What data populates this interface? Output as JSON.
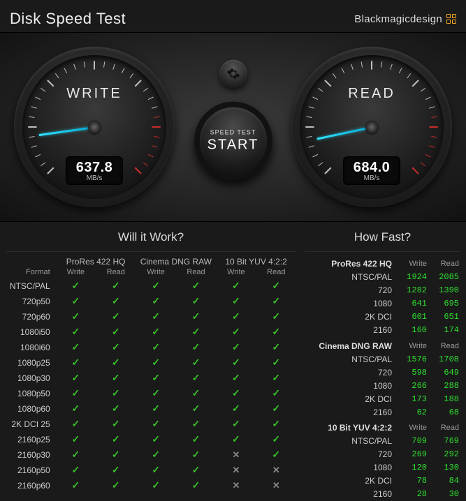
{
  "app": {
    "title": "Disk Speed Test",
    "brand": "Blackmagicdesign"
  },
  "controls": {
    "speed_test_small": "SPEED TEST",
    "start_label": "START"
  },
  "units": "MB/s",
  "gauges": {
    "write": {
      "label": "WRITE",
      "value": "637.8",
      "needle_deg": 172
    },
    "read": {
      "label": "READ",
      "value": "684.0",
      "needle_deg": 168
    }
  },
  "will_it_work": {
    "title": "Will it Work?",
    "format_label": "Format",
    "codecs": [
      "ProRes 422 HQ",
      "Cinema DNG RAW",
      "10 Bit YUV 4:2:2"
    ],
    "sub": [
      "Write",
      "Read"
    ],
    "rows": [
      {
        "fmt": "NTSC/PAL",
        "cells": [
          true,
          true,
          true,
          true,
          true,
          true
        ]
      },
      {
        "fmt": "720p50",
        "cells": [
          true,
          true,
          true,
          true,
          true,
          true
        ]
      },
      {
        "fmt": "720p60",
        "cells": [
          true,
          true,
          true,
          true,
          true,
          true
        ]
      },
      {
        "fmt": "1080i50",
        "cells": [
          true,
          true,
          true,
          true,
          true,
          true
        ]
      },
      {
        "fmt": "1080i60",
        "cells": [
          true,
          true,
          true,
          true,
          true,
          true
        ]
      },
      {
        "fmt": "1080p25",
        "cells": [
          true,
          true,
          true,
          true,
          true,
          true
        ]
      },
      {
        "fmt": "1080p30",
        "cells": [
          true,
          true,
          true,
          true,
          true,
          true
        ]
      },
      {
        "fmt": "1080p50",
        "cells": [
          true,
          true,
          true,
          true,
          true,
          true
        ]
      },
      {
        "fmt": "1080p60",
        "cells": [
          true,
          true,
          true,
          true,
          true,
          true
        ]
      },
      {
        "fmt": "2K DCI 25",
        "cells": [
          true,
          true,
          true,
          true,
          true,
          true
        ]
      },
      {
        "fmt": "2160p25",
        "cells": [
          true,
          true,
          true,
          true,
          true,
          true
        ]
      },
      {
        "fmt": "2160p30",
        "cells": [
          true,
          true,
          true,
          true,
          false,
          true
        ]
      },
      {
        "fmt": "2160p50",
        "cells": [
          true,
          true,
          true,
          true,
          false,
          false
        ]
      },
      {
        "fmt": "2160p60",
        "cells": [
          true,
          true,
          true,
          true,
          false,
          false
        ]
      }
    ]
  },
  "how_fast": {
    "title": "How Fast?",
    "sub": [
      "Write",
      "Read"
    ],
    "groups": [
      {
        "codec": "ProRes 422 HQ",
        "rows": [
          {
            "fmt": "NTSC/PAL",
            "w": "1924",
            "r": "2085"
          },
          {
            "fmt": "720",
            "w": "1282",
            "r": "1390"
          },
          {
            "fmt": "1080",
            "w": "641",
            "r": "695"
          },
          {
            "fmt": "2K DCI",
            "w": "601",
            "r": "651"
          },
          {
            "fmt": "2160",
            "w": "160",
            "r": "174"
          }
        ]
      },
      {
        "codec": "Cinema DNG RAW",
        "rows": [
          {
            "fmt": "NTSC/PAL",
            "w": "1576",
            "r": "1708"
          },
          {
            "fmt": "720",
            "w": "598",
            "r": "649"
          },
          {
            "fmt": "1080",
            "w": "266",
            "r": "288"
          },
          {
            "fmt": "2K DCI",
            "w": "173",
            "r": "188"
          },
          {
            "fmt": "2160",
            "w": "62",
            "r": "68"
          }
        ]
      },
      {
        "codec": "10 Bit YUV 4:2:2",
        "rows": [
          {
            "fmt": "NTSC/PAL",
            "w": "709",
            "r": "769"
          },
          {
            "fmt": "720",
            "w": "269",
            "r": "292"
          },
          {
            "fmt": "1080",
            "w": "120",
            "r": "130"
          },
          {
            "fmt": "2K DCI",
            "w": "78",
            "r": "84"
          },
          {
            "fmt": "2160",
            "w": "28",
            "r": "30"
          }
        ]
      }
    ]
  }
}
